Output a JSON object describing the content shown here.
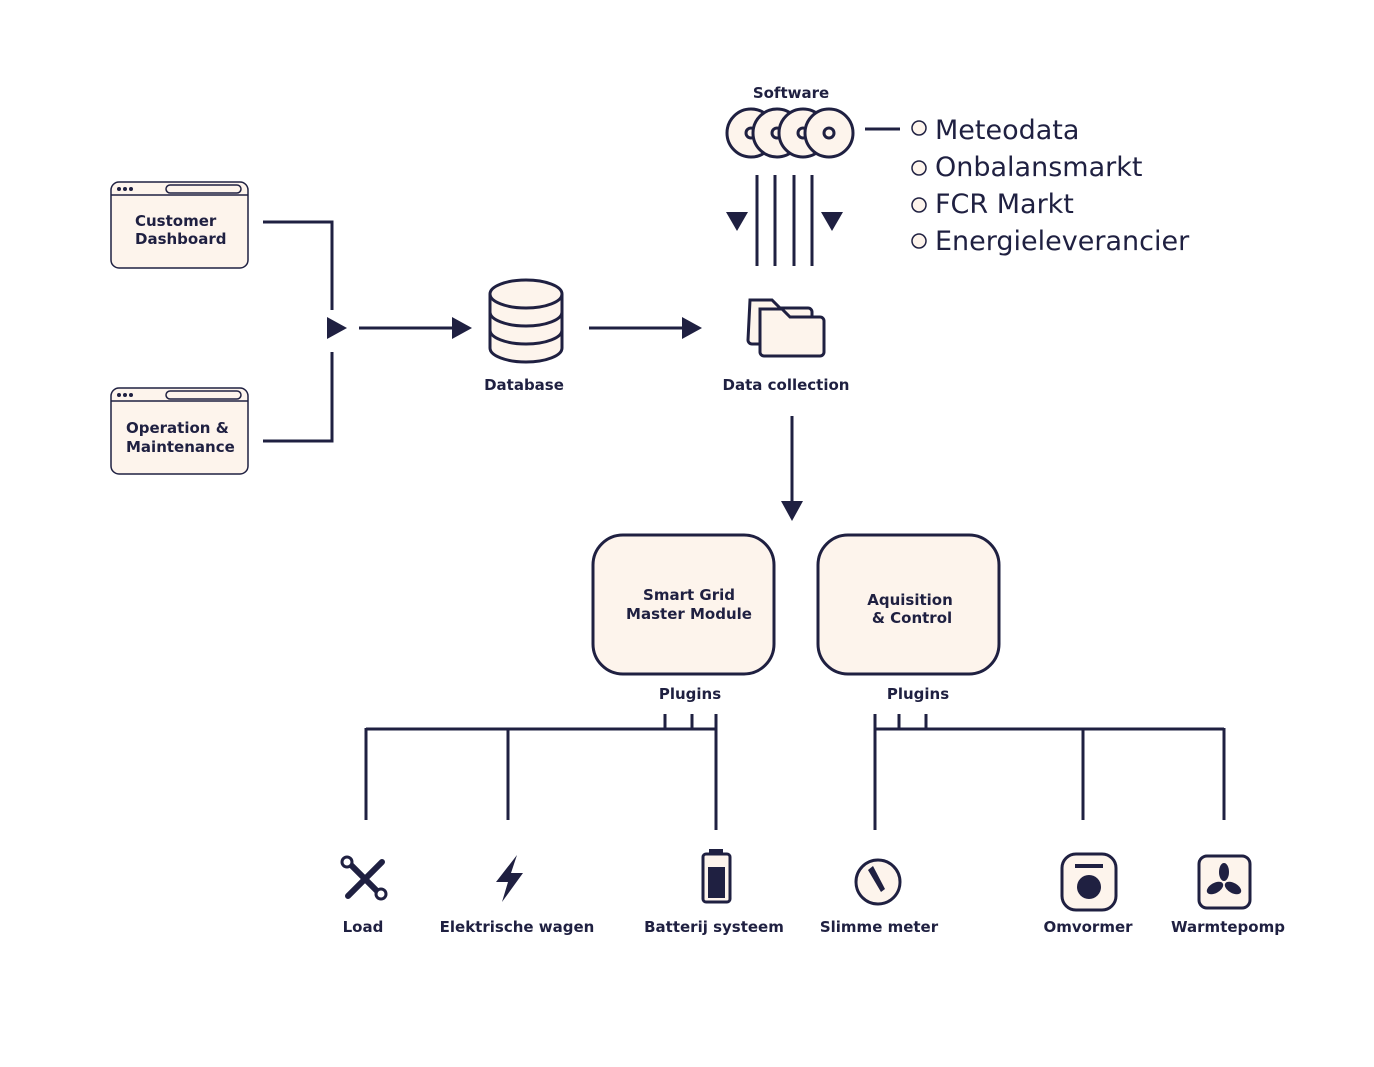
{
  "colors": {
    "ink": "#1f2041",
    "fill": "#fdf4ec",
    "background": "#ffffff"
  },
  "apps": [
    {
      "line1": "Customer",
      "line2": "Dashboard",
      "icon": "browser-window-icon"
    },
    {
      "line1": "Operation &",
      "line2": "Maintenance",
      "icon": "browser-window-icon"
    }
  ],
  "database": {
    "label": "Database",
    "icon": "database-icon"
  },
  "data_collection": {
    "label": "Data collection",
    "icon": "folders-icon"
  },
  "software": {
    "label": "Software",
    "icon": "discs-icon",
    "sources": [
      "Meteodata",
      "Onbalansmarkt",
      "FCR Markt",
      "Energieleverancier"
    ]
  },
  "modules": [
    {
      "line1": "Smart Grid",
      "line2": "Master Module",
      "plugins_label": "Plugins"
    },
    {
      "line1": "Aquisition",
      "line2": "& Control",
      "plugins_label": "Plugins"
    }
  ],
  "devices": [
    {
      "label": "Load",
      "icon": "tools-icon"
    },
    {
      "label": "Elektrische wagen",
      "icon": "lightning-icon"
    },
    {
      "label": "Batterij systeem",
      "icon": "battery-icon"
    },
    {
      "label": "Slimme meter",
      "icon": "gauge-icon"
    },
    {
      "label": "Omvormer",
      "icon": "inverter-icon"
    },
    {
      "label": "Warmtepomp",
      "icon": "fan-icon"
    }
  ]
}
